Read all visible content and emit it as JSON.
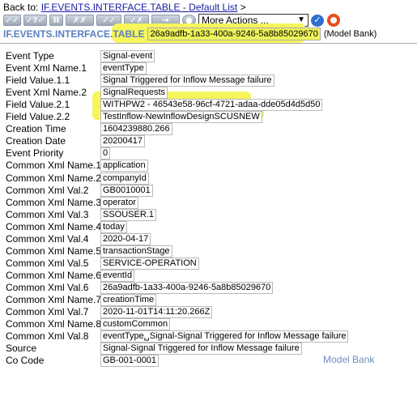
{
  "back": {
    "prefix": "Back to:",
    "link": "IF.EVENTS.INTERFACE.TABLE - Default List",
    "suffix": ">"
  },
  "toolbar": {
    "buttons": [
      "✓✓",
      "✓?✓",
      "II",
      "✗✗",
      "✓✓",
      "✓✗",
      "→",
      "●"
    ],
    "actions_value": "More Actions ...",
    "go_icon": "✓"
  },
  "record": {
    "table": "IF.EVENTS.INTERFACE.TABLE",
    "id": "26a9adfb-1a33-400a-9246-5a8b85029670",
    "company": "(Model Bank)"
  },
  "fields": [
    {
      "label": "Event Type",
      "value": "Signal-event"
    },
    {
      "label": "Event Xml Name.1",
      "value": "eventType"
    },
    {
      "label": "Field Value.1.1",
      "value": "Signal Triggered for Inflow Message failure"
    },
    {
      "label": "Event Xml Name.2",
      "value": "SignalRequests"
    },
    {
      "label": "Field Value.2.1",
      "value": "WITHPW2 - 46543e58-96cf-4721-adaa-dde05d4d5d50"
    },
    {
      "label": "Field Value.2.2",
      "value": "TestInflow-NewInflowDesignSCUSNEW"
    },
    {
      "label": "Creation Time",
      "value": "1604239880.266"
    },
    {
      "label": "Creation Date",
      "value": "20200417"
    },
    {
      "label": "Event Priority",
      "value": "0"
    },
    {
      "label": "Common Xml Name.1",
      "value": "application"
    },
    {
      "label": "Common Xml Name.2",
      "value": "companyId"
    },
    {
      "label": "Common Xml Val.2",
      "value": "GB0010001"
    },
    {
      "label": "Common Xml Name.3",
      "value": "operator"
    },
    {
      "label": "Common Xml Val.3",
      "value": "SSOUSER.1"
    },
    {
      "label": "Common Xml Name.4",
      "value": "today"
    },
    {
      "label": "Common Xml Val.4",
      "value": "2020-04-17"
    },
    {
      "label": "Common Xml Name.5",
      "value": "transactionStage"
    },
    {
      "label": "Common Xml Val.5",
      "value": "SERVICE-OPERATION"
    },
    {
      "label": "Common Xml Name.6",
      "value": "eventId"
    },
    {
      "label": "Common Xml Val.6",
      "value": "26a9adfb-1a33-400a-9246-5a8b85029670"
    },
    {
      "label": "Common Xml Name.7",
      "value": "creationTime"
    },
    {
      "label": "Common Xml Val.7",
      "value": "2020-11-01T14:11:20.266Z"
    },
    {
      "label": "Common Xml Name.8",
      "value": "customCommon"
    },
    {
      "label": "Common Xml Val.8",
      "value": "eventType␣Signal-Signal Triggered for Inflow Message failure"
    },
    {
      "label": "Source",
      "value": "Signal-Signal Triggered for Inflow Message failure"
    },
    {
      "label": "Co Code",
      "value": "GB-001-0001"
    }
  ],
  "footer": {
    "company": "Model Bank"
  },
  "colors": {
    "highlight": "#f6f55c",
    "link": "#1a1aa6",
    "table_title": "#5b7fc2"
  }
}
